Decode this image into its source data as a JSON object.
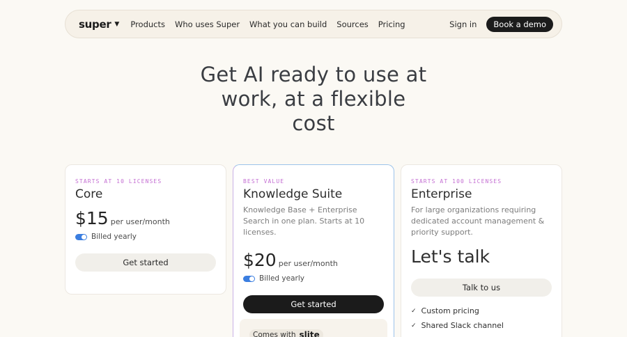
{
  "nav": {
    "logo": "super",
    "links": [
      "Products",
      "Who uses Super",
      "What you can build",
      "Sources",
      "Pricing"
    ],
    "sign_in": "Sign in",
    "cta": "Book a demo"
  },
  "hero": {
    "lines": [
      "Get AI ready to use at",
      "work, at a flexible",
      "cost"
    ]
  },
  "plans": {
    "core": {
      "eyebrow": "STARTS AT 10 LICENSES",
      "name": "Core",
      "price": "$15",
      "per": "per user/month",
      "billing": "Billed yearly",
      "button": "Get started"
    },
    "knowledge": {
      "eyebrow": "BEST VALUE",
      "name": "Knowledge Suite",
      "description": "Knowledge Base + Enterprise Search in one plan. Starts at 10 licenses.",
      "price": "$20",
      "per": "per user/month",
      "billing": "Billed yearly",
      "button": "Get started",
      "comes_with": "Comes with",
      "partner": "slite"
    },
    "enterprise": {
      "eyebrow": "STARTS AT 100 LICENSES",
      "name": "Enterprise",
      "description": "For large organizations requiring dedicated account management & priority support.",
      "price_text": "Let's talk",
      "button": "Talk to us",
      "features": [
        "Custom pricing",
        "Shared Slack channel"
      ]
    }
  },
  "colors": {
    "accent_eyebrow": "#c46fd3",
    "toggle": "#3b7ee0",
    "dark_button": "#1b1b1b"
  }
}
